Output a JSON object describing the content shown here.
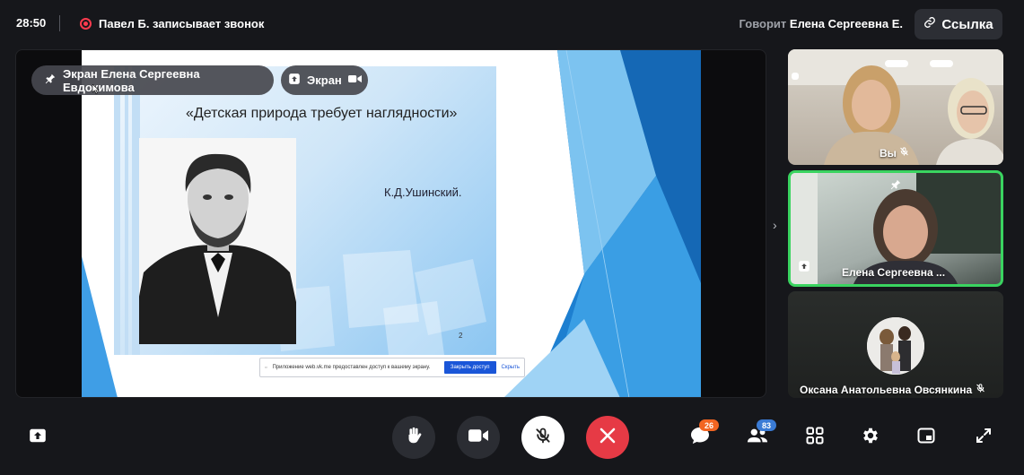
{
  "header": {
    "timer": "28:50",
    "recording_text": "Павел Б. записывает звонок",
    "speaking_prefix": "Говорит",
    "speaking_name": "Елена Сергеевна Е.",
    "link_label": "Ссылка"
  },
  "stage": {
    "pinned_label": "Экран Елена Сергеевна Евдокимова",
    "screen_label": "Экран",
    "slide": {
      "title": "«Детская природа требует наглядности»",
      "author": "К.Д.Ушинский.",
      "page_number": "2"
    },
    "share_bar": {
      "text": "Приложение web.vk.me предоставлен доступ к вашему экрану.",
      "stop_label": "Закрыть доступ",
      "hide_label": "Скрыть"
    }
  },
  "participants": [
    {
      "name": "Вы",
      "muted": true
    },
    {
      "name": "Елена Сергеевна ...",
      "sharing": true,
      "pinned": true,
      "speaking": true
    },
    {
      "name": "Оксана Анатольевна Овсянкина",
      "muted": true
    }
  ],
  "toolbar": {
    "chat_badge": "26",
    "participants_badge": "83"
  },
  "colors": {
    "background": "#16171b",
    "accent_red": "#e63a45",
    "speaking_border": "#3ad460",
    "badge_orange": "#f26522",
    "badge_blue": "#3a7bd5"
  }
}
